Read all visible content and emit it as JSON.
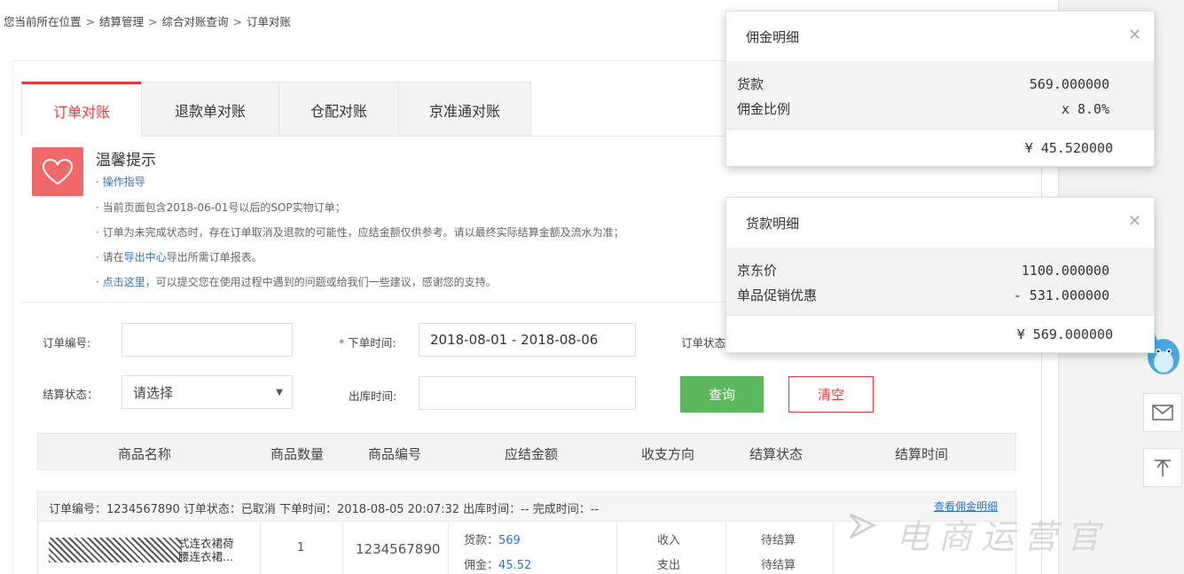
{
  "breadcrumb": [
    "您当前所在位置",
    "结算管理",
    "综合对账查询",
    "订单对账"
  ],
  "tabs": [
    "订单对账",
    "退款单对账",
    "仓配对账",
    "京准通对账"
  ],
  "tips": {
    "title": "温馨提示",
    "guide_link": "操作指导",
    "line1": "· 当前页面包含2018-06-01号以后的SOP实物订单；",
    "line2": "· 订单为未完成状态时，存在订单取消及退款的可能性，应结金额仅供参考。请以最终实际结算金额及流水为准；",
    "line3_a": "· 请在",
    "line3_link": "导出中心",
    "line3_b": "导出所需订单报表。",
    "line4_link": "点击这里",
    "line4_b": "，可以提交您在使用过程中遇到的问题或给我们一些建议，感谢您的支持。"
  },
  "filters": {
    "order_no_label": "订单编号:",
    "order_time_label": "下单时间:",
    "order_time_value": "2018-08-01 - 2018-08-06",
    "order_status_label": "订单状态",
    "settle_status_label": "结算状态：",
    "settle_status_value": "请选择",
    "outbound_label": "出库时间:",
    "query_button": "查询",
    "clear_button": "清空"
  },
  "table": {
    "headers": [
      "商品名称",
      "商品数量",
      "商品编号",
      "应结金额",
      "收支方向",
      "结算状态",
      "结算时间"
    ],
    "order_info": "订单编号：1234567890  订单状态：已取消  下单时间：2018-08-05 20:07:32  出库时间：--  完成时间：--",
    "order_link": "查看佣金明细",
    "row": {
      "product_name": "式连衣裙荷\n腰连衣裙...",
      "quantity": "1",
      "product_no": "1234567890",
      "goods_label": "货款：",
      "goods_value": "569",
      "commission_label": "佣金：",
      "commission_value": "45.52",
      "direction_in": "收入",
      "direction_out": "支出",
      "status_1": "待结算",
      "status_2": "待结算"
    }
  },
  "commission_popup": {
    "title": "佣金明细",
    "row1_label": "货款",
    "row1_value": "569.000000",
    "row2_label": "佣金比例",
    "row2_value": "x 8.0%",
    "total": "¥ 45.520000"
  },
  "goods_popup": {
    "title": "货款明细",
    "row1_label": "京东价",
    "row1_value": "1100.000000",
    "row2_label": "单品促销优惠",
    "row2_value": "- 531.000000",
    "total": "¥ 569.000000"
  },
  "watermark": "电商运营官",
  "icons": {
    "heart": "heart-icon",
    "close": "close-icon",
    "mail": "mail-icon",
    "top": "back-to-top-icon"
  }
}
